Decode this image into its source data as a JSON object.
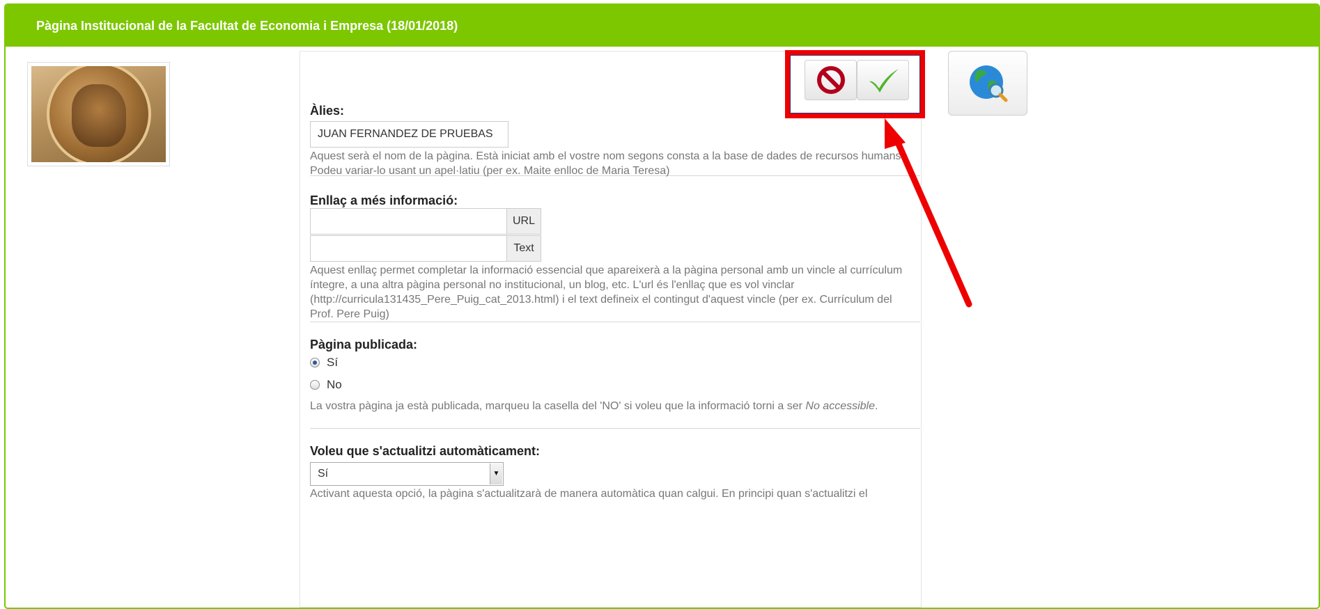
{
  "header": {
    "title": "Pàgina Institucional de la Facultat de Economia i Empresa (18/01/2018)"
  },
  "alias": {
    "label": "Àlies:",
    "value": "JUAN FERNANDEZ DE PRUEBAS",
    "help": "Aquest serà el nom de la pàgina. Està iniciat amb el vostre nom segons consta a la base de dades de recursos humans. Podeu variar-lo usant un apel·latiu (per ex. Maite enlloc de Maria Teresa)"
  },
  "link": {
    "label": "Enllaç a més informació:",
    "url_addon": "URL",
    "text_addon": "Text",
    "url_value": "",
    "text_value": "",
    "help": "Aquest enllaç permet completar la informació essencial que apareixerà a la pàgina personal amb un vincle al currículum íntegre, a una altra pàgina personal no institucional, un blog, etc. L'url és l'enllaç que es vol vinclar (http://curricula131435_Pere_Puig_cat_2013.html) i el text defineix el contingut d'aquest vincle (per ex. Currículum del Prof. Pere Puig)"
  },
  "published": {
    "label": "Pàgina publicada:",
    "options": [
      "Sí",
      "No"
    ],
    "selected": "Sí",
    "help_prefix": "La vostra pàgina ja està publicada, marqueu la casella del 'NO' si voleu que la informació torni a ser ",
    "help_emph": "No accessible",
    "help_suffix": "."
  },
  "autoupdate": {
    "label": "Voleu que s'actualitzi automàticament:",
    "selected": "Sí",
    "help": "Activant aquesta opció, la pàgina s'actualitzarà de manera automàtica quan calgui. En principi quan s'actualitzi el"
  },
  "colors": {
    "header": "#7cc700",
    "highlight": "#ee0000",
    "cancel": "#b3001b",
    "check": "#4fb52a"
  },
  "icons": {
    "cancel": "prohibited-icon",
    "save": "checkmark-icon",
    "preview": "globe-search-icon"
  }
}
